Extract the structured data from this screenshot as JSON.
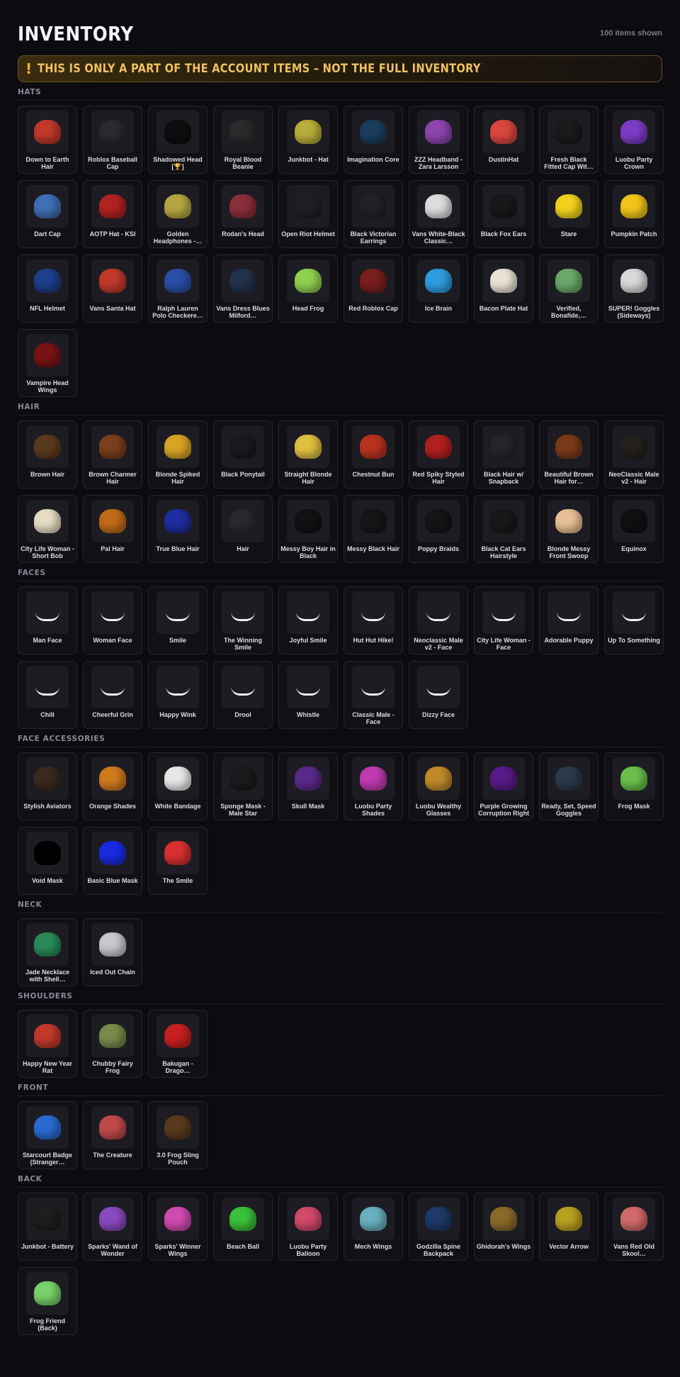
{
  "header": {
    "title": "INVENTORY",
    "count": "100 items shown"
  },
  "warning": {
    "icon": "exclamation-icon",
    "text": "THIS IS ONLY A PART OF THE ACCOUNT ITEMS – NOT THE FULL INVENTORY"
  },
  "sections": [
    {
      "title": "HATS",
      "items": [
        {
          "name": "Down to Earth Hair",
          "color": "#c0392b"
        },
        {
          "name": "Roblox Baseball Cap",
          "color": "#2a2a30"
        },
        {
          "name": "Shadowed Head [🏆]",
          "color": "#0e0e10"
        },
        {
          "name": "Royal Blood Beanie",
          "color": "#2b2b2b"
        },
        {
          "name": "Junkbot - Hat",
          "color": "#b8ad3a"
        },
        {
          "name": "Imagination Core",
          "color": "#1a3d5c"
        },
        {
          "name": "ZZZ Headband - Zara Larsson",
          "color": "#8e44ad"
        },
        {
          "name": "DustinHat",
          "color": "#d9473f"
        },
        {
          "name": "Fresh Black Fitted Cap Wit…",
          "color": "#1a1a1a"
        },
        {
          "name": "Luobu Party Crown",
          "color": "#7d3cc8"
        },
        {
          "name": "Dart Cap",
          "color": "#3f6fb5"
        },
        {
          "name": "AOTP Hat - KSI",
          "color": "#b22222"
        },
        {
          "name": "Golden Headphones -…",
          "color": "#b5a642"
        },
        {
          "name": "Rodan's Head",
          "color": "#8b2e3a"
        },
        {
          "name": "Open Riot Helmet",
          "color": "#202024"
        },
        {
          "name": "Black Victorian Earrings",
          "color": "#222226"
        },
        {
          "name": "Vans White-Black Classic…",
          "color": "#dcdcdc"
        },
        {
          "name": "Black Fox Ears",
          "color": "#18181b"
        },
        {
          "name": "Stare",
          "color": "#f2d21b"
        },
        {
          "name": "Pumpkin Patch",
          "color": "#f0c419"
        },
        {
          "name": "NFL Helmet",
          "color": "#1e3f8a"
        },
        {
          "name": "Vans Santa Hat",
          "color": "#c0392b"
        },
        {
          "name": "Ralph Lauren Polo Checkere…",
          "color": "#2a4ea6"
        },
        {
          "name": "Vans Dress Blues Milford…",
          "color": "#22324a"
        },
        {
          "name": "Head Frog",
          "color": "#8fd14f"
        },
        {
          "name": "Red Roblox Cap",
          "color": "#7a1e1e"
        },
        {
          "name": "Ice Brain",
          "color": "#2f9de0"
        },
        {
          "name": "Bacon Plate Hat",
          "color": "#e8e2d6"
        },
        {
          "name": "Verified, Bonafide,…",
          "color": "#6aa96a"
        },
        {
          "name": "SUPER! Goggles (Sideways)",
          "color": "#d8d8d8"
        },
        {
          "name": "Vampire Head Wings",
          "color": "#7a1414"
        }
      ]
    },
    {
      "title": "HAIR",
      "items": [
        {
          "name": "Brown Hair",
          "color": "#5a3a1e"
        },
        {
          "name": "Brown Charmer Hair",
          "color": "#7a3f1c"
        },
        {
          "name": "Blonde Spiked Hair",
          "color": "#d8a424"
        },
        {
          "name": "Black Ponytail",
          "color": "#1a1a1e"
        },
        {
          "name": "Straight Blonde Hair",
          "color": "#e0c040"
        },
        {
          "name": "Chestnut Bun",
          "color": "#b8321e"
        },
        {
          "name": "Red Spiky Styled Hair",
          "color": "#b02020"
        },
        {
          "name": "Black Hair w/ Snapback",
          "color": "#26262a"
        },
        {
          "name": "Beautiful Brown Hair for…",
          "color": "#7a3a1a"
        },
        {
          "name": "NeoClassic Male v2 - Hair",
          "color": "#24201e"
        },
        {
          "name": "City Life Woman - Short Bob",
          "color": "#e6dcc4"
        },
        {
          "name": "Pal Hair",
          "color": "#c06a18"
        },
        {
          "name": "True Blue Hair",
          "color": "#1e2ea0"
        },
        {
          "name": "Hair",
          "color": "#2a2a2e"
        },
        {
          "name": "Messy Boy Hair in Black",
          "color": "#121214"
        },
        {
          "name": "Messy Black Hair",
          "color": "#161618"
        },
        {
          "name": "Poppy Braids",
          "color": "#141416"
        },
        {
          "name": "Black Cat Ears Hairstyle",
          "color": "#18181a"
        },
        {
          "name": "Blonde Messy Front Swoop",
          "color": "#e8c096"
        },
        {
          "name": "Equinox",
          "color": "#101012"
        }
      ]
    },
    {
      "title": "FACES",
      "items": [
        {
          "name": "Man Face",
          "color": "#0a0a0a"
        },
        {
          "name": "Woman Face",
          "color": "#0a0a0a"
        },
        {
          "name": "Smile",
          "color": "#0a0a0a"
        },
        {
          "name": "The Winning Smile",
          "color": "#0a0a0a"
        },
        {
          "name": "Joyful Smile",
          "color": "#0a0a0a"
        },
        {
          "name": "Hut Hut Hike!",
          "color": "#0a0a0a"
        },
        {
          "name": "Neoclassic Male v2 - Face",
          "color": "#0a0a0a"
        },
        {
          "name": "City Life Woman - Face",
          "color": "#0a0a0a"
        },
        {
          "name": "Adorable Puppy",
          "color": "#0a0a0a"
        },
        {
          "name": "Up To Something",
          "color": "#0a0a0a"
        },
        {
          "name": "Chill",
          "color": "#0a0a0a"
        },
        {
          "name": "Cheerful Grin",
          "color": "#0a0a0a"
        },
        {
          "name": "Happy Wink",
          "color": "#0a0a0a"
        },
        {
          "name": "Drool",
          "color": "#0a0a0a"
        },
        {
          "name": "Whistle",
          "color": "#0a0a0a"
        },
        {
          "name": "Classic Male - Face",
          "color": "#0a0a0a"
        },
        {
          "name": "Dizzy Face",
          "color": "#0a0a0a"
        }
      ]
    },
    {
      "title": "FACE ACCESSORIES",
      "items": [
        {
          "name": "Stylish Aviators",
          "color": "#3a2a1e"
        },
        {
          "name": "Orange Shades",
          "color": "#d07a1e"
        },
        {
          "name": "White Bandage",
          "color": "#e8e8e8"
        },
        {
          "name": "Sponge Mask - Male Star",
          "color": "#1a1a1c"
        },
        {
          "name": "Skull Mask",
          "color": "#5a2a8a"
        },
        {
          "name": "Luobu Party Shades",
          "color": "#c03ab0"
        },
        {
          "name": "Luobu Wealthy Glasses",
          "color": "#c08a2a"
        },
        {
          "name": "Purple Growing Corruption Right",
          "color": "#5a1a8a"
        },
        {
          "name": "Ready, Set, Speed Goggles",
          "color": "#2a3a4a"
        },
        {
          "name": "Frog Mask",
          "color": "#6ac04a"
        },
        {
          "name": "Void Mask",
          "color": "#000000"
        },
        {
          "name": "Basic Blue Mask",
          "color": "#1a2ae0"
        },
        {
          "name": "The Smile",
          "color": "#d83030"
        }
      ]
    },
    {
      "title": "NECK",
      "items": [
        {
          "name": "Jade Necklace with Shell…",
          "color": "#2a8a5a"
        },
        {
          "name": "Iced Out Chain",
          "color": "#c8c8cc"
        }
      ]
    },
    {
      "title": "SHOULDERS",
      "items": [
        {
          "name": "Happy New Year Rat",
          "color": "#c0392b"
        },
        {
          "name": "Chubby Fairy Frog",
          "color": "#7a8a4a"
        },
        {
          "name": "Bakugan - Drago…",
          "color": "#c82020"
        }
      ]
    },
    {
      "title": "FRONT",
      "items": [
        {
          "name": "Starcourt Badge (Stranger…",
          "color": "#2a6ad0"
        },
        {
          "name": "The Creature",
          "color": "#c04a4a"
        },
        {
          "name": "3.0 Frog Sling Pouch",
          "color": "#5a3a1e"
        }
      ]
    },
    {
      "title": "BACK",
      "items": [
        {
          "name": "Junkbot - Battery",
          "color": "#1e1e1e"
        },
        {
          "name": "Sparks' Wand of Wonder",
          "color": "#8a4ac0"
        },
        {
          "name": "Sparks' Winner Wings",
          "color": "#d04ab0"
        },
        {
          "name": "Beach Ball",
          "color": "#3ac03a"
        },
        {
          "name": "Luobu Party Balloon",
          "color": "#d04a6a"
        },
        {
          "name": "Mech Wings",
          "color": "#6ab0c0"
        },
        {
          "name": "Godzilla Spine Backpack",
          "color": "#1e3a6a"
        },
        {
          "name": "Ghidorah's Wings",
          "color": "#8a6a2a"
        },
        {
          "name": "Vector Arrow",
          "color": "#b8a020"
        },
        {
          "name": "Vans Red Old Skool…",
          "color": "#d06a6a"
        },
        {
          "name": "Frog Friend (Back)",
          "color": "#7ad06a"
        }
      ]
    }
  ]
}
